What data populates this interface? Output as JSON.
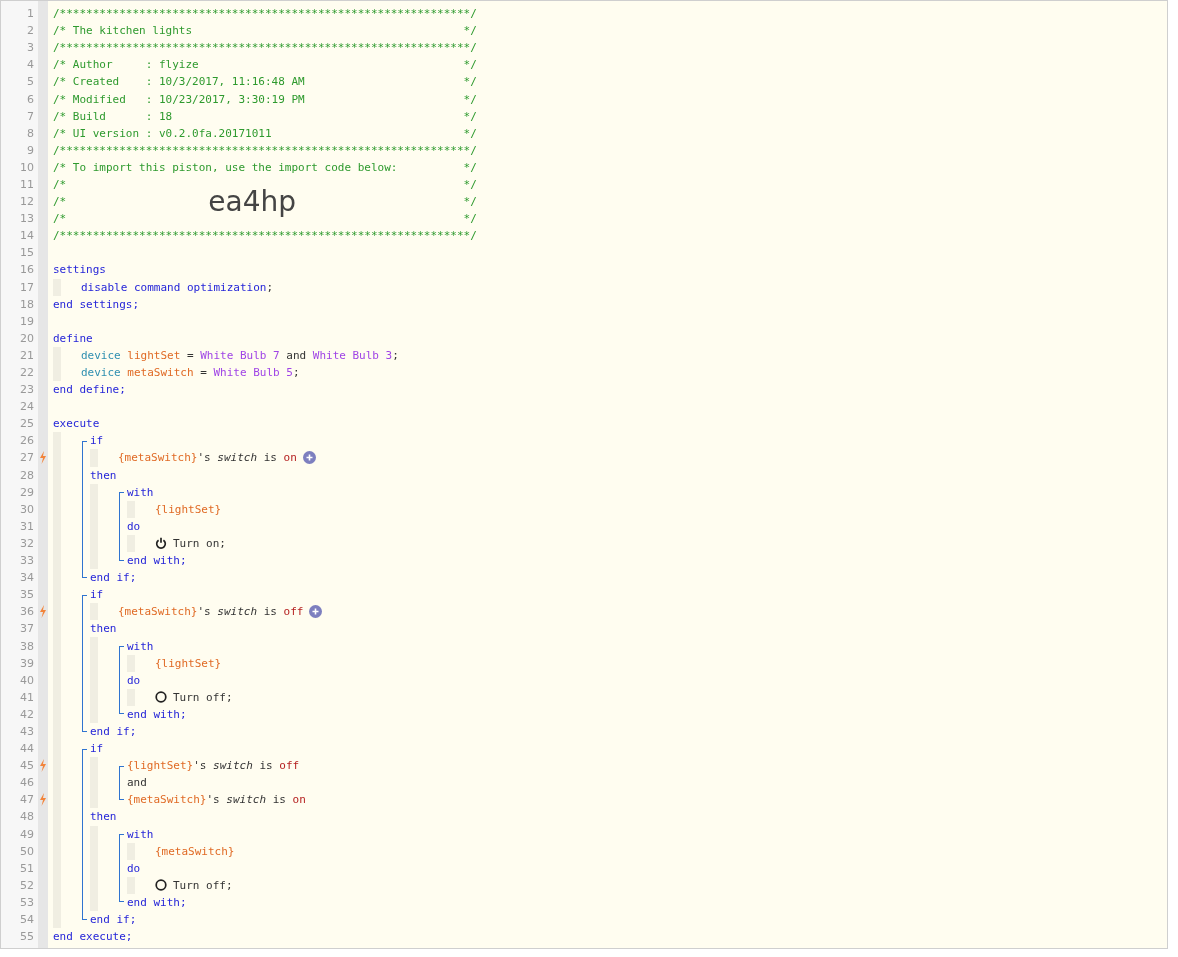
{
  "code": [
    {
      "kind": "line",
      "number": "1",
      "trigger": false,
      "tokens": [
        {
          "text": "/**************************************************************/",
          "kind": "comment"
        }
      ]
    },
    {
      "kind": "line",
      "number": "2",
      "trigger": false,
      "tokens": [
        {
          "text": "/* The kitchen lights",
          "kind": "comment"
        },
        {
          "text": "*/",
          "kind": "comment-end"
        }
      ]
    },
    {
      "kind": "line",
      "number": "3",
      "trigger": false,
      "tokens": [
        {
          "text": "/**************************************************************/",
          "kind": "comment"
        }
      ]
    },
    {
      "kind": "line",
      "number": "4",
      "trigger": false,
      "tokens": [
        {
          "text": "/* Author     : flyize",
          "kind": "comment"
        },
        {
          "text": "*/",
          "kind": "comment-end"
        }
      ]
    },
    {
      "kind": "line",
      "number": "5",
      "trigger": false,
      "tokens": [
        {
          "text": "/* Created    : 10/3/2017, 11:16:48 AM",
          "kind": "comment"
        },
        {
          "text": "*/",
          "kind": "comment-end"
        }
      ]
    },
    {
      "kind": "line",
      "number": "6",
      "trigger": false,
      "tokens": [
        {
          "text": "/* Modified   : 10/23/2017, 3:30:19 PM",
          "kind": "comment"
        },
        {
          "text": "*/",
          "kind": "comment-end"
        }
      ]
    },
    {
      "kind": "line",
      "number": "7",
      "trigger": false,
      "tokens": [
        {
          "text": "/* Build      : 18",
          "kind": "comment"
        },
        {
          "text": "*/",
          "kind": "comment-end"
        }
      ]
    },
    {
      "kind": "line",
      "number": "8",
      "trigger": false,
      "tokens": [
        {
          "text": "/* UI version : v0.2.0fa.20171011",
          "kind": "comment"
        },
        {
          "text": "*/",
          "kind": "comment-end"
        }
      ]
    },
    {
      "kind": "line",
      "number": "9",
      "trigger": false,
      "tokens": [
        {
          "text": "/**************************************************************/",
          "kind": "comment"
        }
      ]
    },
    {
      "kind": "line",
      "number": "10",
      "trigger": false,
      "tokens": [
        {
          "text": "/* To import this piston, use the import code below:",
          "kind": "comment"
        },
        {
          "text": "*/",
          "kind": "comment-end"
        }
      ]
    },
    {
      "kind": "line",
      "number": "11",
      "trigger": false,
      "tokens": [
        {
          "text": "/*",
          "kind": "comment"
        },
        {
          "text": "*/",
          "kind": "comment-end"
        }
      ]
    },
    {
      "kind": "line",
      "number": "12",
      "trigger": false,
      "tokens": [
        {
          "text": "/*",
          "kind": "comment"
        },
        {
          "text": "ea4hp",
          "kind": "import-code"
        },
        {
          "text": "*/",
          "kind": "comment-end"
        }
      ]
    },
    {
      "kind": "line",
      "number": "13",
      "trigger": false,
      "tokens": [
        {
          "text": "/*",
          "kind": "comment"
        },
        {
          "text": "*/",
          "kind": "comment-end"
        }
      ]
    },
    {
      "kind": "line",
      "number": "14",
      "trigger": false,
      "tokens": [
        {
          "text": "/**************************************************************/",
          "kind": "comment"
        }
      ]
    },
    {
      "kind": "line",
      "number": "15",
      "trigger": false
    },
    {
      "kind": "line",
      "number": "16",
      "trigger": false,
      "tokens": [
        {
          "text": "settings",
          "kind": "keyword"
        }
      ]
    },
    {
      "kind": "indent",
      "children": [
        {
          "kind": "line",
          "number": "17",
          "trigger": false,
          "tokens": [
            {
              "text": "disable command optimization",
              "kind": "keyword"
            },
            {
              "text": ";",
              "kind": "plain"
            }
          ]
        }
      ]
    },
    {
      "kind": "line",
      "number": "18",
      "trigger": false,
      "tokens": [
        {
          "text": "end settings;",
          "kind": "keyword"
        }
      ]
    },
    {
      "kind": "line",
      "number": "19",
      "trigger": false
    },
    {
      "kind": "line",
      "number": "20",
      "trigger": false,
      "tokens": [
        {
          "text": "define",
          "kind": "keyword"
        }
      ]
    },
    {
      "kind": "indent",
      "children": [
        {
          "kind": "line",
          "number": "21",
          "trigger": false,
          "tokens": [
            {
              "text": "device",
              "kind": "type"
            },
            {
              "text": "lightSet",
              "kind": "variable",
              "space": true
            },
            {
              "text": "=",
              "kind": "plain",
              "space": true
            },
            {
              "text": "White Bulb 7",
              "kind": "device",
              "space": true
            },
            {
              "text": "and",
              "kind": "plain",
              "space": true
            },
            {
              "text": "White Bulb 3",
              "kind": "device",
              "space": true
            },
            {
              "text": ";",
              "kind": "plain"
            }
          ]
        },
        {
          "kind": "line",
          "number": "22",
          "trigger": false,
          "tokens": [
            {
              "text": "device",
              "kind": "type"
            },
            {
              "text": "metaSwitch",
              "kind": "variable",
              "space": true
            },
            {
              "text": "=",
              "kind": "plain",
              "space": true
            },
            {
              "text": "White Bulb 5",
              "kind": "device",
              "space": true
            },
            {
              "text": ";",
              "kind": "plain"
            }
          ]
        }
      ]
    },
    {
      "kind": "line",
      "number": "23",
      "trigger": false,
      "tokens": [
        {
          "text": "end define;",
          "kind": "keyword"
        }
      ]
    },
    {
      "kind": "line",
      "number": "24",
      "trigger": false
    },
    {
      "kind": "line",
      "number": "25",
      "trigger": false,
      "tokens": [
        {
          "text": "execute",
          "kind": "keyword"
        }
      ]
    },
    {
      "kind": "indent",
      "children": [
        {
          "kind": "bracket",
          "children": [
            {
              "kind": "line",
              "number": "26",
              "trigger": false,
              "tokens": [
                {
                  "text": "if",
                  "kind": "keyword"
                }
              ]
            },
            {
              "kind": "indent",
              "children": [
                {
                  "kind": "line",
                  "number": "27",
                  "trigger": true,
                  "tokens": [
                    {
                      "text": "{metaSwitch}",
                      "kind": "variable"
                    },
                    {
                      "text": "'s",
                      "kind": "plain"
                    },
                    {
                      "text": "switch",
                      "kind": "attribute",
                      "space": true
                    },
                    {
                      "text": "is",
                      "kind": "plain",
                      "space": true
                    },
                    {
                      "text": "on",
                      "kind": "value",
                      "space": true
                    },
                    {
                      "kind": "add"
                    }
                  ]
                }
              ]
            },
            {
              "kind": "line",
              "number": "28",
              "trigger": false,
              "tokens": [
                {
                  "text": "then",
                  "kind": "keyword"
                }
              ]
            },
            {
              "kind": "indent",
              "children": [
                {
                  "kind": "bracket",
                  "children": [
                    {
                      "kind": "line",
                      "number": "29",
                      "trigger": false,
                      "tokens": [
                        {
                          "text": "with",
                          "kind": "keyword"
                        }
                      ]
                    },
                    {
                      "kind": "indent",
                      "children": [
                        {
                          "kind": "line",
                          "number": "30",
                          "trigger": false,
                          "tokens": [
                            {
                              "text": "{lightSet}",
                              "kind": "variable"
                            }
                          ]
                        }
                      ]
                    },
                    {
                      "kind": "line",
                      "number": "31",
                      "trigger": false,
                      "tokens": [
                        {
                          "text": "do",
                          "kind": "keyword"
                        }
                      ]
                    },
                    {
                      "kind": "indent",
                      "children": [
                        {
                          "kind": "line",
                          "number": "32",
                          "trigger": false,
                          "tokens": [
                            {
                              "kind": "power"
                            },
                            {
                              "text": "Turn on;",
                              "kind": "plain"
                            }
                          ]
                        }
                      ]
                    },
                    {
                      "kind": "line",
                      "number": "33",
                      "trigger": false,
                      "tokens": [
                        {
                          "text": "end with;",
                          "kind": "keyword"
                        }
                      ]
                    }
                  ]
                }
              ]
            },
            {
              "kind": "line",
              "number": "34",
              "trigger": false,
              "tokens": [
                {
                  "text": "end if;",
                  "kind": "keyword"
                }
              ]
            }
          ]
        },
        {
          "kind": "bracket",
          "children": [
            {
              "kind": "line",
              "number": "35",
              "trigger": false,
              "tokens": [
                {
                  "text": "if",
                  "kind": "keyword"
                }
              ]
            },
            {
              "kind": "indent",
              "children": [
                {
                  "kind": "line",
                  "number": "36",
                  "trigger": true,
                  "tokens": [
                    {
                      "text": "{metaSwitch}",
                      "kind": "variable"
                    },
                    {
                      "text": "'s",
                      "kind": "plain"
                    },
                    {
                      "text": "switch",
                      "kind": "attribute",
                      "space": true
                    },
                    {
                      "text": "is",
                      "kind": "plain",
                      "space": true
                    },
                    {
                      "text": "off",
                      "kind": "value",
                      "space": true
                    },
                    {
                      "kind": "add"
                    }
                  ]
                }
              ]
            },
            {
              "kind": "line",
              "number": "37",
              "trigger": false,
              "tokens": [
                {
                  "text": "then",
                  "kind": "keyword"
                }
              ]
            },
            {
              "kind": "indent",
              "children": [
                {
                  "kind": "bracket",
                  "children": [
                    {
                      "kind": "line",
                      "number": "38",
                      "trigger": false,
                      "tokens": [
                        {
                          "text": "with",
                          "kind": "keyword"
                        }
                      ]
                    },
                    {
                      "kind": "indent",
                      "children": [
                        {
                          "kind": "line",
                          "number": "39",
                          "trigger": false,
                          "tokens": [
                            {
                              "text": "{lightSet}",
                              "kind": "variable"
                            }
                          ]
                        }
                      ]
                    },
                    {
                      "kind": "line",
                      "number": "40",
                      "trigger": false,
                      "tokens": [
                        {
                          "text": "do",
                          "kind": "keyword"
                        }
                      ]
                    },
                    {
                      "kind": "indent",
                      "children": [
                        {
                          "kind": "line",
                          "number": "41",
                          "trigger": false,
                          "tokens": [
                            {
                              "kind": "ring"
                            },
                            {
                              "text": "Turn off;",
                              "kind": "plain"
                            }
                          ]
                        }
                      ]
                    },
                    {
                      "kind": "line",
                      "number": "42",
                      "trigger": false,
                      "tokens": [
                        {
                          "text": "end with;",
                          "kind": "keyword"
                        }
                      ]
                    }
                  ]
                }
              ]
            },
            {
              "kind": "line",
              "number": "43",
              "trigger": false,
              "tokens": [
                {
                  "text": "end if;",
                  "kind": "keyword"
                }
              ]
            }
          ]
        },
        {
          "kind": "bracket",
          "children": [
            {
              "kind": "line",
              "number": "44",
              "trigger": false,
              "tokens": [
                {
                  "text": "if",
                  "kind": "keyword"
                }
              ]
            },
            {
              "kind": "indent",
              "children": [
                {
                  "kind": "bracket",
                  "children": [
                    {
                      "kind": "line",
                      "number": "45",
                      "trigger": true,
                      "tokens": [
                        {
                          "text": "{lightSet}",
                          "kind": "variable"
                        },
                        {
                          "text": "'s",
                          "kind": "plain"
                        },
                        {
                          "text": "switch",
                          "kind": "attribute",
                          "space": true
                        },
                        {
                          "text": "is",
                          "kind": "plain",
                          "space": true
                        },
                        {
                          "text": "off",
                          "kind": "value",
                          "space": true
                        }
                      ]
                    },
                    {
                      "kind": "line",
                      "number": "46",
                      "trigger": false,
                      "tokens": [
                        {
                          "text": "and",
                          "kind": "plain"
                        }
                      ]
                    },
                    {
                      "kind": "line",
                      "number": "47",
                      "trigger": true,
                      "tokens": [
                        {
                          "text": "{metaSwitch}",
                          "kind": "variable"
                        },
                        {
                          "text": "'s",
                          "kind": "plain"
                        },
                        {
                          "text": "switch",
                          "kind": "attribute",
                          "space": true
                        },
                        {
                          "text": "is",
                          "kind": "plain",
                          "space": true
                        },
                        {
                          "text": "on",
                          "kind": "value",
                          "space": true
                        }
                      ]
                    }
                  ]
                }
              ]
            },
            {
              "kind": "line",
              "number": "48",
              "trigger": false,
              "tokens": [
                {
                  "text": "then",
                  "kind": "keyword"
                }
              ]
            },
            {
              "kind": "indent",
              "children": [
                {
                  "kind": "bracket",
                  "children": [
                    {
                      "kind": "line",
                      "number": "49",
                      "trigger": false,
                      "tokens": [
                        {
                          "text": "with",
                          "kind": "keyword"
                        }
                      ]
                    },
                    {
                      "kind": "indent",
                      "children": [
                        {
                          "kind": "line",
                          "number": "50",
                          "trigger": false,
                          "tokens": [
                            {
                              "text": "{metaSwitch}",
                              "kind": "variable"
                            }
                          ]
                        }
                      ]
                    },
                    {
                      "kind": "line",
                      "number": "51",
                      "trigger": false,
                      "tokens": [
                        {
                          "text": "do",
                          "kind": "keyword"
                        }
                      ]
                    },
                    {
                      "kind": "indent",
                      "children": [
                        {
                          "kind": "line",
                          "number": "52",
                          "trigger": false,
                          "tokens": [
                            {
                              "kind": "ring"
                            },
                            {
                              "text": "Turn off;",
                              "kind": "plain"
                            }
                          ]
                        }
                      ]
                    },
                    {
                      "kind": "line",
                      "number": "53",
                      "trigger": false,
                      "tokens": [
                        {
                          "text": "end with;",
                          "kind": "keyword"
                        }
                      ]
                    }
                  ]
                }
              ]
            },
            {
              "kind": "line",
              "number": "54",
              "trigger": false,
              "tokens": [
                {
                  "text": "end if;",
                  "kind": "keyword"
                }
              ]
            }
          ]
        }
      ]
    },
    {
      "kind": "line",
      "number": "55",
      "trigger": false,
      "tokens": [
        {
          "text": "end execute;",
          "kind": "keyword"
        }
      ]
    }
  ]
}
